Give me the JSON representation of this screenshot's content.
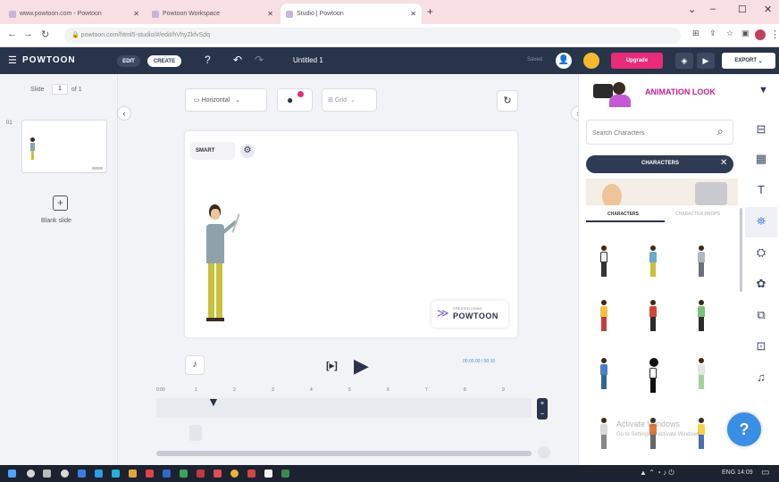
{
  "browser": {
    "tabs": [
      {
        "label": "www.powtoon.com - Powtoon",
        "active": false
      },
      {
        "label": "Powtoon Workspace",
        "active": false
      },
      {
        "label": "Studio | Powtoon",
        "active": true
      }
    ],
    "new_tab": "+",
    "url": "powtoon.com/html5-studio/#/edit/hVhyZkfvSdq"
  },
  "app": {
    "logo": "POWTOON",
    "mode_edit": "EDIT",
    "mode_create": "CREATE",
    "doc_title": "Untitled 1",
    "saved": "Saved",
    "upgrade": "Upgrade",
    "export": "EXPORT"
  },
  "left_panel": {
    "slide_label": "Slide",
    "slide_num": "1",
    "slide_of": "of 1",
    "thumb_num": "01",
    "blank_slide": "Blank slide"
  },
  "toolbar": {
    "orientation": "Horizontal",
    "grid_label": "Grid"
  },
  "canvas": {
    "smart_label": "SMART",
    "watermark_small": "CREATED USING",
    "watermark_brand": "POWTOON"
  },
  "timeline": {
    "time": "00:00.00 / 00:10",
    "ticks": [
      "0:00",
      "1",
      "2",
      "3",
      "4",
      "5",
      "6",
      "7",
      "8",
      "9"
    ]
  },
  "right_panel": {
    "title": "ANIMATION LOOK",
    "search_placeholder": "Search Characters",
    "chip": "CHARACTERS",
    "tab_characters": "CHARACTERS",
    "tab_character_props": "CHARACTER PROPS"
  },
  "watermark": {
    "line1": "Activate Windows",
    "line2": "Go to Settings to activate Windows."
  },
  "help": "?",
  "taskbar": {
    "tray": "ENG  14:09"
  },
  "colors": {
    "header": "#27344a",
    "accent_pink": "#e92c78",
    "accent_blue": "#4d8bd8",
    "chip_dark": "#2f3b53"
  }
}
